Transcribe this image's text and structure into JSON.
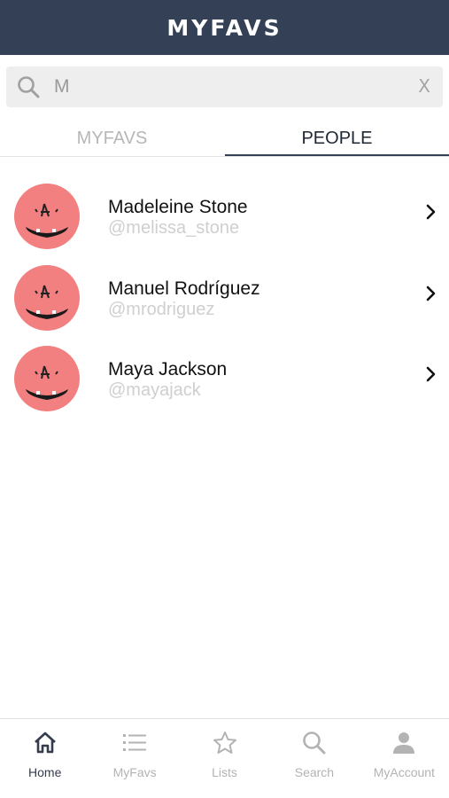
{
  "header": {
    "title": "MYFAVS"
  },
  "search": {
    "value": "M",
    "clear_label": "X"
  },
  "tabs": [
    {
      "label": "MYFAVS",
      "active": false
    },
    {
      "label": "PEOPLE",
      "active": true
    }
  ],
  "people": [
    {
      "name": "Madeleine Stone",
      "handle": "@melissa_stone"
    },
    {
      "name": "Manuel Rodríguez",
      "handle": "@mrodriguez"
    },
    {
      "name": "Maya Jackson",
      "handle": "@mayajack"
    }
  ],
  "nav": [
    {
      "label": "Home",
      "icon": "home-icon",
      "active": true
    },
    {
      "label": "MyFavs",
      "icon": "list-icon",
      "active": false
    },
    {
      "label": "Lists",
      "icon": "star-icon",
      "active": false
    },
    {
      "label": "Search",
      "icon": "search-icon",
      "active": false
    },
    {
      "label": "MyAccount",
      "icon": "user-icon",
      "active": false
    }
  ],
  "colors": {
    "header_bg": "#334055",
    "avatar_bg": "#f28080",
    "active_tab_underline": "#334055",
    "inactive_text": "#b7b7b7",
    "handle_text": "#cfcfcf"
  }
}
